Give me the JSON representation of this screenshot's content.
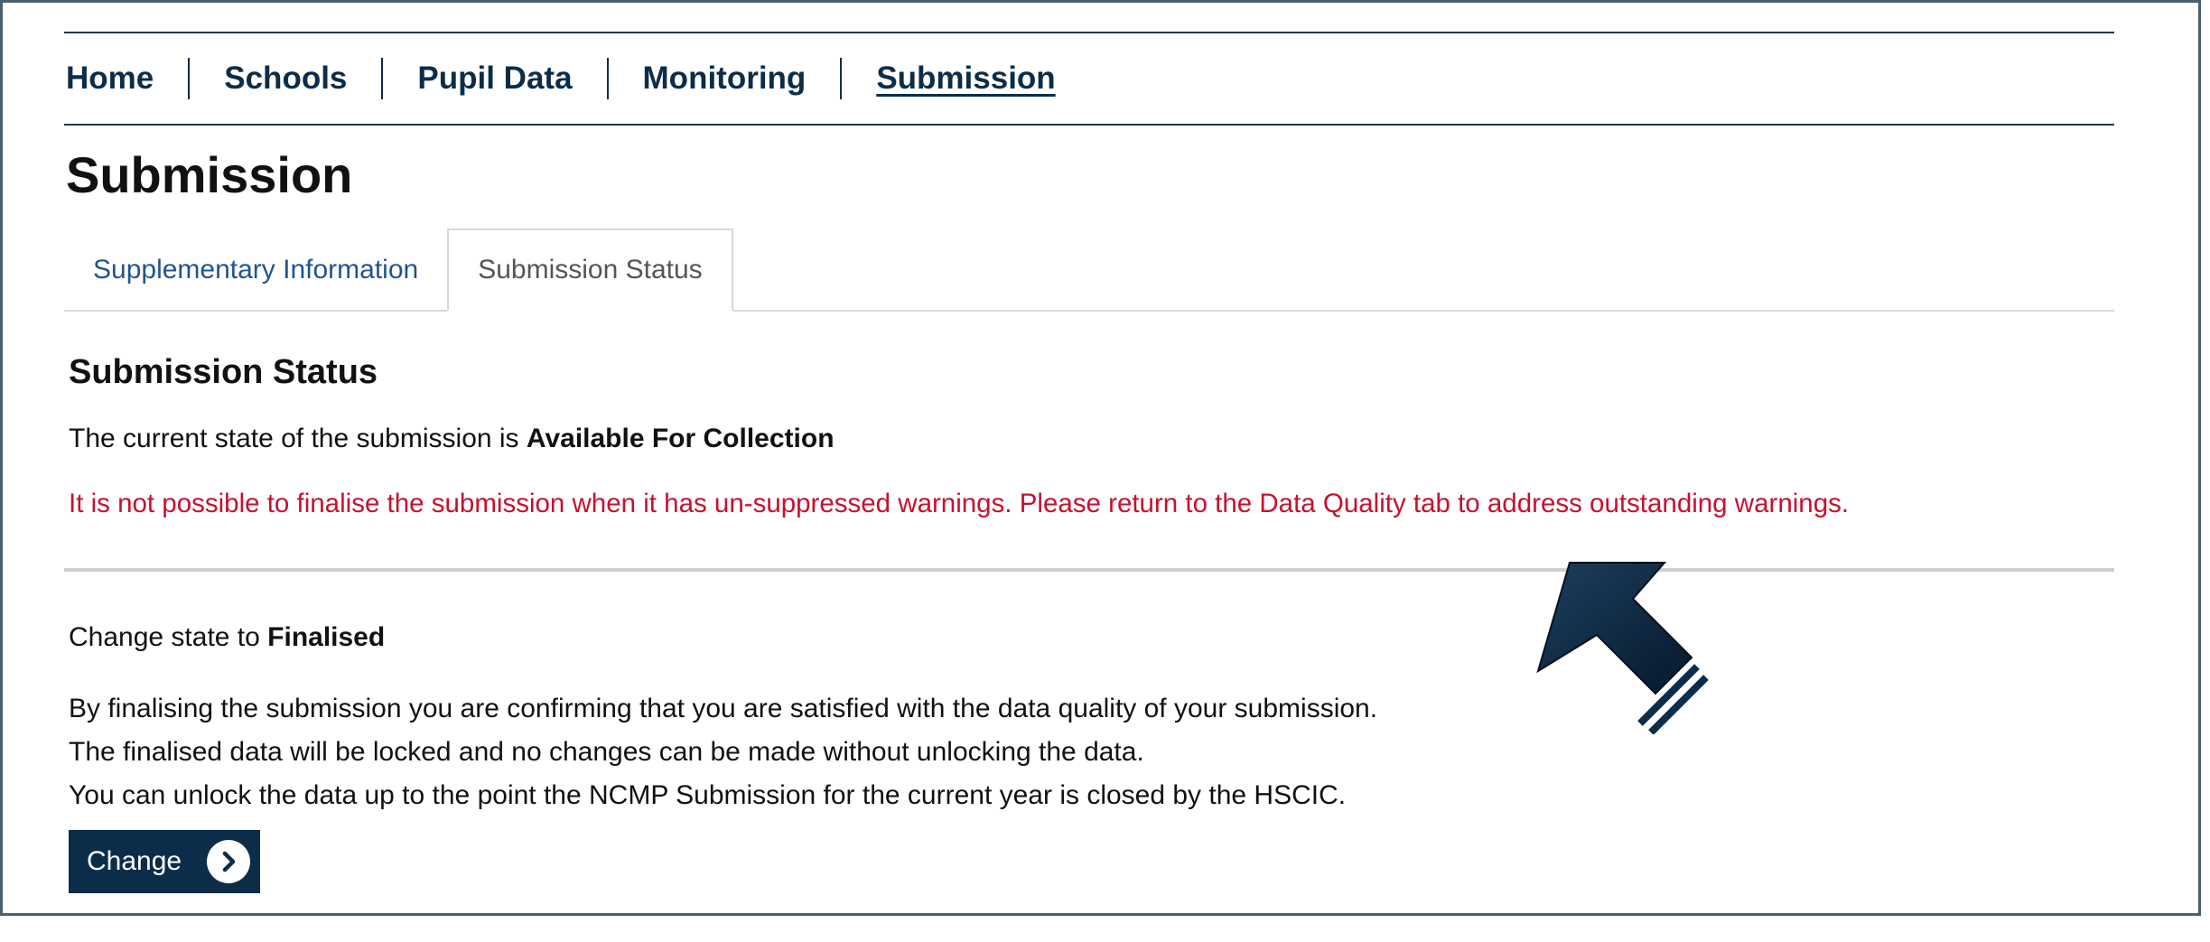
{
  "nav": {
    "items": [
      {
        "label": "Home"
      },
      {
        "label": "Schools"
      },
      {
        "label": "Pupil Data"
      },
      {
        "label": "Monitoring"
      },
      {
        "label": "Submission"
      }
    ]
  },
  "page": {
    "title": "Submission"
  },
  "tabs": [
    {
      "label": "Supplementary Information"
    },
    {
      "label": "Submission Status"
    }
  ],
  "status": {
    "heading": "Submission Status",
    "current_prefix": "The current state of the submission is ",
    "current_state": "Available For Collection",
    "warning": "It is not possible to finalise the submission when it has un-suppressed warnings. Please return to the Data Quality tab to address outstanding warnings."
  },
  "change": {
    "prefix": "Change state to ",
    "target_state": "Finalised",
    "lines": [
      "By finalising the submission you are confirming that you are satisfied with the data quality of your submission.",
      "The finalised data will be locked and no changes can be made without unlocking the data.",
      "You can unlock the data up to the point the NCMP Submission for the current year is closed by the HSCIC."
    ],
    "button_label": "Change",
    "button_icon": "chevron-right-icon"
  },
  "colors": {
    "nav_text": "#0b2d4a",
    "link_blue": "#1f5590",
    "warning_red": "#c8102e",
    "button_bg": "#0b2d4a"
  }
}
